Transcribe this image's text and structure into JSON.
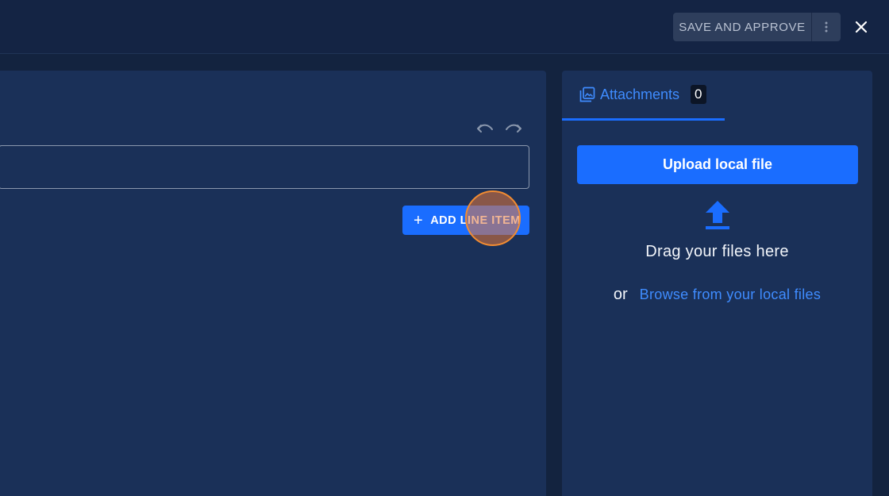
{
  "header": {
    "save_approve_label": "SAVE AND APPROVE",
    "more_icon": "more-vertical-icon",
    "close_icon": "close-icon"
  },
  "editor": {
    "undo_icon": "undo-icon",
    "redo_icon": "redo-icon",
    "input_value": "",
    "add_line_item_label": "ADD LINE ITEM"
  },
  "attachments": {
    "tab_label": "Attachments",
    "count": "0",
    "upload_button_label": "Upload local file",
    "drag_text": "Drag your files here",
    "or_text": "or",
    "browse_link": "Browse from your local files"
  },
  "colors": {
    "accent": "#1a6dff",
    "link": "#3f8cff",
    "panel": "#1a3058",
    "background": "#13233f"
  }
}
